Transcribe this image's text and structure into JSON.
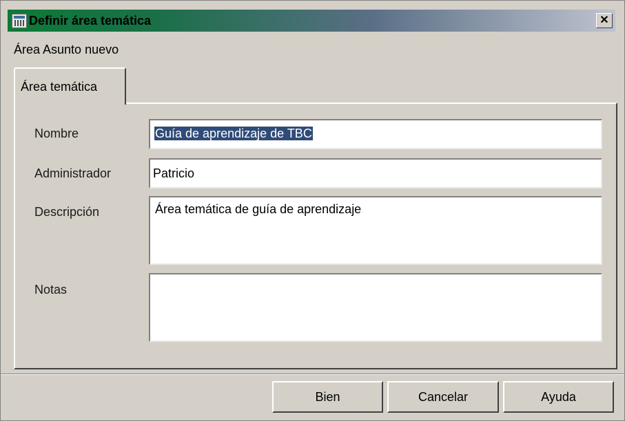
{
  "window": {
    "title": "Definir área temática",
    "icon": "table-icon",
    "close_symbol": "✕"
  },
  "subtitle": "Área Asunto nuevo",
  "tab": {
    "label": "Área temática"
  },
  "form": {
    "nombre_label": "Nombre",
    "nombre_value": "Guía de aprendizaje de TBC",
    "administrador_label": "Administrador",
    "administrador_value": "Patricio",
    "descripcion_label": "Descripción",
    "descripcion_value": "Área temática de guía de aprendizaje",
    "notas_label": "Notas",
    "notas_value": ""
  },
  "buttons": {
    "ok": "Bien",
    "cancel": "Cancelar",
    "help": "Ayuda"
  },
  "colors": {
    "title_gradient_start": "#0c7a36",
    "title_gradient_end": "#bfc3cf",
    "selection": "#2f4b78",
    "face": "#d4d0c8"
  }
}
